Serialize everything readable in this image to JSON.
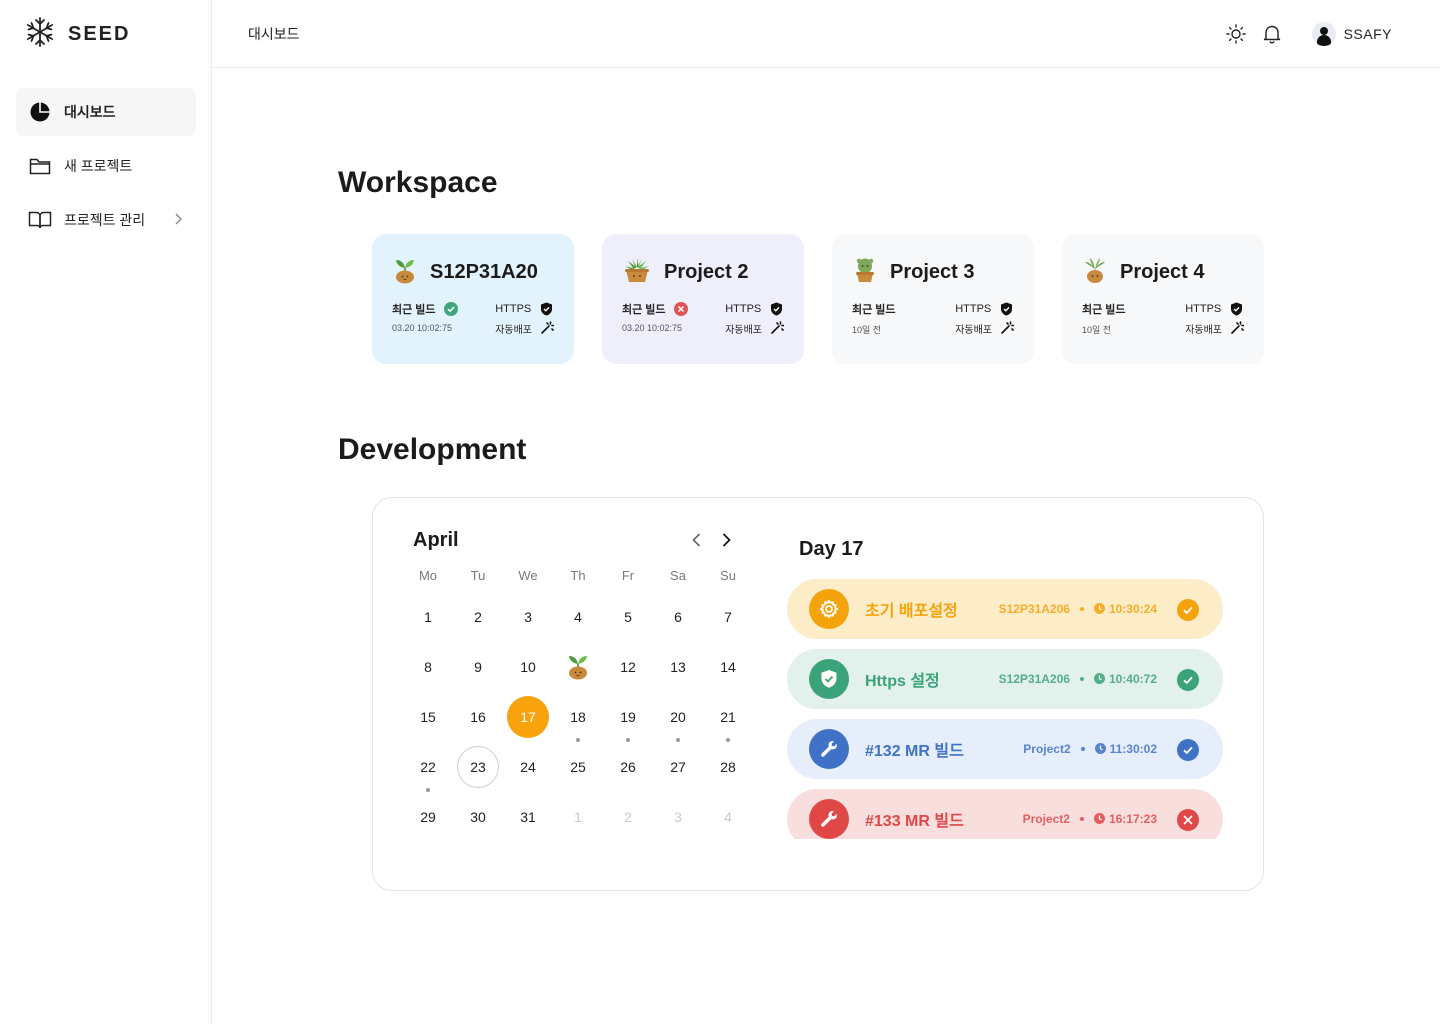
{
  "app": {
    "logo_text": "SEED"
  },
  "sidebar": {
    "items": [
      {
        "label": "대시보드",
        "icon": "pie-chart-icon",
        "active": true
      },
      {
        "label": "새 프로젝트",
        "icon": "folder-icon",
        "active": false
      },
      {
        "label": "프로젝트 관리",
        "icon": "book-icon",
        "active": false
      }
    ]
  },
  "header": {
    "breadcrumb": "대시보드",
    "user_name": "SSAFY"
  },
  "workspace": {
    "title": "Workspace",
    "projects": [
      {
        "name": "S12P31A20",
        "bg": "#e3f3fd",
        "build_label": "최근 빌드",
        "build_status": "success",
        "build_time": "03.20 10:02:75",
        "https_label": "HTTPS",
        "deploy_label": "자동배포"
      },
      {
        "name": "Project 2",
        "bg": "#efeffc",
        "build_label": "최근 빌드",
        "build_status": "fail",
        "build_time": "03.20 10:02:75",
        "https_label": "HTTPS",
        "deploy_label": "자동배포"
      },
      {
        "name": "Project 3",
        "bg": "#f7f8fa",
        "build_label": "최근 빌드",
        "build_status": "none",
        "build_time": "10일 전",
        "https_label": "HTTPS",
        "deploy_label": "자동배포"
      },
      {
        "name": "Project 4",
        "bg": "#f7f8fa",
        "build_label": "최근 빌드",
        "build_status": "none",
        "build_time": "10일 전",
        "https_label": "HTTPS",
        "deploy_label": "자동배포"
      }
    ]
  },
  "development": {
    "title": "Development",
    "calendar": {
      "month": "April",
      "weekdays": [
        "Mo",
        "Tu",
        "We",
        "Th",
        "Fr",
        "Sa",
        "Su"
      ],
      "days": [
        "1",
        "2",
        "3",
        "4",
        "5",
        "6",
        "7",
        "8",
        "9",
        "10",
        "11",
        "12",
        "13",
        "14",
        "15",
        "16",
        "17",
        "18",
        "19",
        "20",
        "21",
        "22",
        "23",
        "24",
        "25",
        "26",
        "27",
        "28",
        "29",
        "30",
        "31",
        "1",
        "2",
        "3",
        "4"
      ],
      "selected_day": "17",
      "today_day": "23",
      "dot_days": [
        "18",
        "19",
        "20",
        "21",
        "22"
      ],
      "sprout_day": "11"
    },
    "day_title": "Day 17",
    "events": [
      {
        "title": "초기 배포설정",
        "project": "S12P31A206",
        "time": "10:30:24",
        "status": "success",
        "icon": "gear-icon",
        "bg": "#fdecc8",
        "accent": "#f5a30b"
      },
      {
        "title": "Https 설정",
        "project": "S12P31A206",
        "time": "10:40:72",
        "status": "success",
        "icon": "shield-check-icon",
        "bg": "#e3f1ec",
        "accent": "#3aa37a"
      },
      {
        "title": "#132 MR 빌드",
        "project": "Project2",
        "time": "11:30:02",
        "status": "success",
        "icon": "wrench-icon",
        "bg": "#e7eefb",
        "accent": "#3f72c6"
      },
      {
        "title": "#133 MR 빌드",
        "project": "Project2",
        "time": "16:17:23",
        "status": "fail",
        "icon": "wrench-icon",
        "bg": "#f9dede",
        "accent": "#e04848"
      }
    ]
  }
}
